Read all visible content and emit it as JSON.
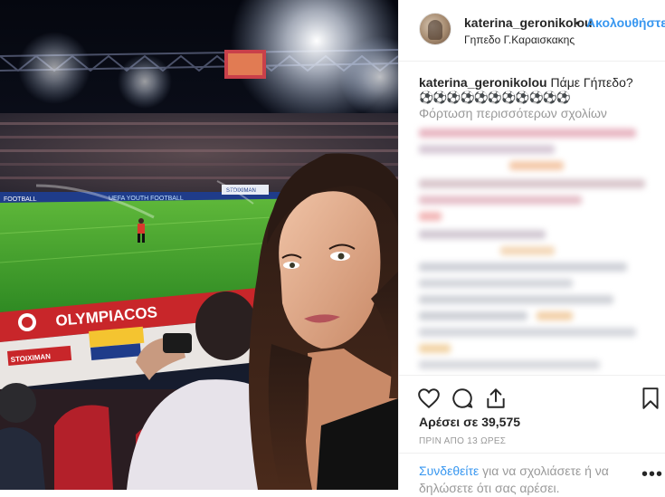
{
  "post": {
    "username": "katerina_geronikolou",
    "separator": "•",
    "follow_label": "Ακολουθήστε",
    "location": "Γηπεδο Γ.Καραισκακης",
    "caption_user": "katerina_geronikolou",
    "caption_text": "Πάμε Γήπεδο?",
    "caption_emojis": "⚽⚽⚽⚽⚽⚽⚽⚽⚽⚽⚽",
    "load_more_label": "Φόρτωση περισσότερων σχολίων",
    "likes_text": "Αρέσει σε 39,575",
    "time_ago": "ΠΡΙΝ ΑΠΟ 13 ΩΡΕΣ",
    "login_link": "Συνδεθείτε",
    "login_rest": " για να σχολιάσετε ή να δηλώσετε ότι σας αρέσει.",
    "more_options": "•••"
  },
  "photo": {
    "banner_text": "OLYMPIACOS",
    "pitch_sign_left": "FOOTBALL",
    "pitch_sign_mid": "UEFA YOUTH FOOTBALL",
    "pitch_sign_right": "STOIXIMAN",
    "board_text": "STOIXIMAN"
  },
  "icons": {
    "like": "heart-icon",
    "comment": "comment-icon",
    "share": "share-icon",
    "save": "bookmark-icon",
    "more": "more-options-icon"
  },
  "colors": {
    "link_blue": "#3897f0",
    "text": "#262626",
    "muted": "#999999",
    "border": "#efefef"
  }
}
